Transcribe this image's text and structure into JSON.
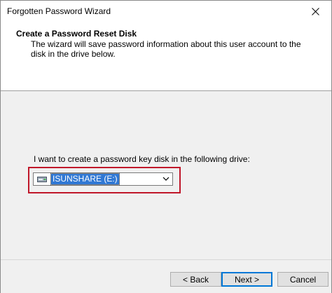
{
  "window": {
    "title": "Forgotten Password Wizard"
  },
  "header": {
    "title": "Create a Password Reset Disk",
    "description": "The wizard will save password information about this user account to the disk in the drive below."
  },
  "main": {
    "prompt": "I want to create a password key disk in the following drive:",
    "drive_select": {
      "selected": "ISUNSHARE (E:)",
      "icon": "drive-icon"
    }
  },
  "footer": {
    "back_label": "< Back",
    "next_label": "Next >",
    "cancel_label": "Cancel"
  },
  "colors": {
    "highlight_border": "#c0172a",
    "selection": "#3078d4",
    "default_button_border": "#0078d7"
  }
}
